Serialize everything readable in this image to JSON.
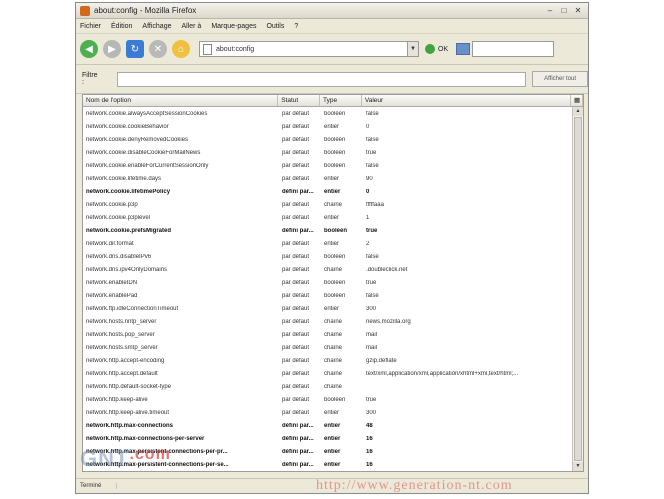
{
  "window": {
    "title": "about:config - Mozilla Firefox"
  },
  "menu": [
    "Fichier",
    "Édition",
    "Affichage",
    "Aller à",
    "Marque-pages",
    "Outils",
    "?"
  ],
  "nav": {
    "url": "about:config",
    "go_label": "OK"
  },
  "filter": {
    "label": "Filtre :",
    "value": "",
    "button": "Afficher tout"
  },
  "table": {
    "headers": [
      "Nom de l'option",
      "Statut",
      "Type",
      "Valeur"
    ],
    "rows": [
      {
        "name": "network.cookie.alwaysAcceptSessionCookies",
        "status": "par défaut",
        "type": "booléen",
        "value": "false"
      },
      {
        "name": "network.cookie.cookieBehavior",
        "status": "par défaut",
        "type": "entier",
        "value": "0"
      },
      {
        "name": "network.cookie.denyRemovedCookies",
        "status": "par défaut",
        "type": "booléen",
        "value": "false"
      },
      {
        "name": "network.cookie.disableCookieForMailNews",
        "status": "par défaut",
        "type": "booléen",
        "value": "true"
      },
      {
        "name": "network.cookie.enableForCurrentSessionOnly",
        "status": "par défaut",
        "type": "booléen",
        "value": "false"
      },
      {
        "name": "network.cookie.lifetime.days",
        "status": "par défaut",
        "type": "entier",
        "value": "90"
      },
      {
        "name": "network.cookie.lifetimePolicy",
        "status": "défini par...",
        "type": "entier",
        "value": "0",
        "bold": true
      },
      {
        "name": "network.cookie.p3p",
        "status": "par défaut",
        "type": "chaîne",
        "value": "fffffaaa"
      },
      {
        "name": "network.cookie.p3plevel",
        "status": "par défaut",
        "type": "entier",
        "value": "1"
      },
      {
        "name": "network.cookie.prefsMigrated",
        "status": "défini par...",
        "type": "booléen",
        "value": "true",
        "bold": true
      },
      {
        "name": "network.dir.format",
        "status": "par défaut",
        "type": "entier",
        "value": "2"
      },
      {
        "name": "network.dns.disableIPv6",
        "status": "par défaut",
        "type": "booléen",
        "value": "false"
      },
      {
        "name": "network.dns.ipv4OnlyDomains",
        "status": "par défaut",
        "type": "chaîne",
        "value": ".doubleclick.net"
      },
      {
        "name": "network.enableIDN",
        "status": "par défaut",
        "type": "booléen",
        "value": "true"
      },
      {
        "name": "network.enablePad",
        "status": "par défaut",
        "type": "booléen",
        "value": "false"
      },
      {
        "name": "network.ftp.idleConnectionTimeout",
        "status": "par défaut",
        "type": "entier",
        "value": "300"
      },
      {
        "name": "network.hosts.nntp_server",
        "status": "par défaut",
        "type": "chaîne",
        "value": "news.mozilla.org"
      },
      {
        "name": "network.hosts.pop_server",
        "status": "par défaut",
        "type": "chaîne",
        "value": "mail"
      },
      {
        "name": "network.hosts.smtp_server",
        "status": "par défaut",
        "type": "chaîne",
        "value": "mail"
      },
      {
        "name": "network.http.accept-encoding",
        "status": "par défaut",
        "type": "chaîne",
        "value": "gzip,deflate"
      },
      {
        "name": "network.http.accept.default",
        "status": "par défaut",
        "type": "chaîne",
        "value": "text/xml,application/xml,application/xhtml+xml,text/html;..."
      },
      {
        "name": "network.http.default-socket-type",
        "status": "par défaut",
        "type": "chaîne",
        "value": ""
      },
      {
        "name": "network.http.keep-alive",
        "status": "par défaut",
        "type": "booléen",
        "value": "true"
      },
      {
        "name": "network.http.keep-alive.timeout",
        "status": "par défaut",
        "type": "entier",
        "value": "300"
      },
      {
        "name": "network.http.max-connections",
        "status": "défini par...",
        "type": "entier",
        "value": "48",
        "bold": true
      },
      {
        "name": "network.http.max-connections-per-server",
        "status": "défini par...",
        "type": "entier",
        "value": "16",
        "bold": true
      },
      {
        "name": "network.http.max-persistent-connections-per-pr...",
        "status": "défini par...",
        "type": "entier",
        "value": "16",
        "bold": true
      },
      {
        "name": "network.http.max-persistent-connections-per-se...",
        "status": "défini par...",
        "type": "entier",
        "value": "16",
        "bold": true
      }
    ]
  },
  "status": {
    "text": "Terminé"
  },
  "watermark": {
    "logo_a": "GNT",
    "logo_b": ".com",
    "url": "http://www.generation-nt.com"
  }
}
